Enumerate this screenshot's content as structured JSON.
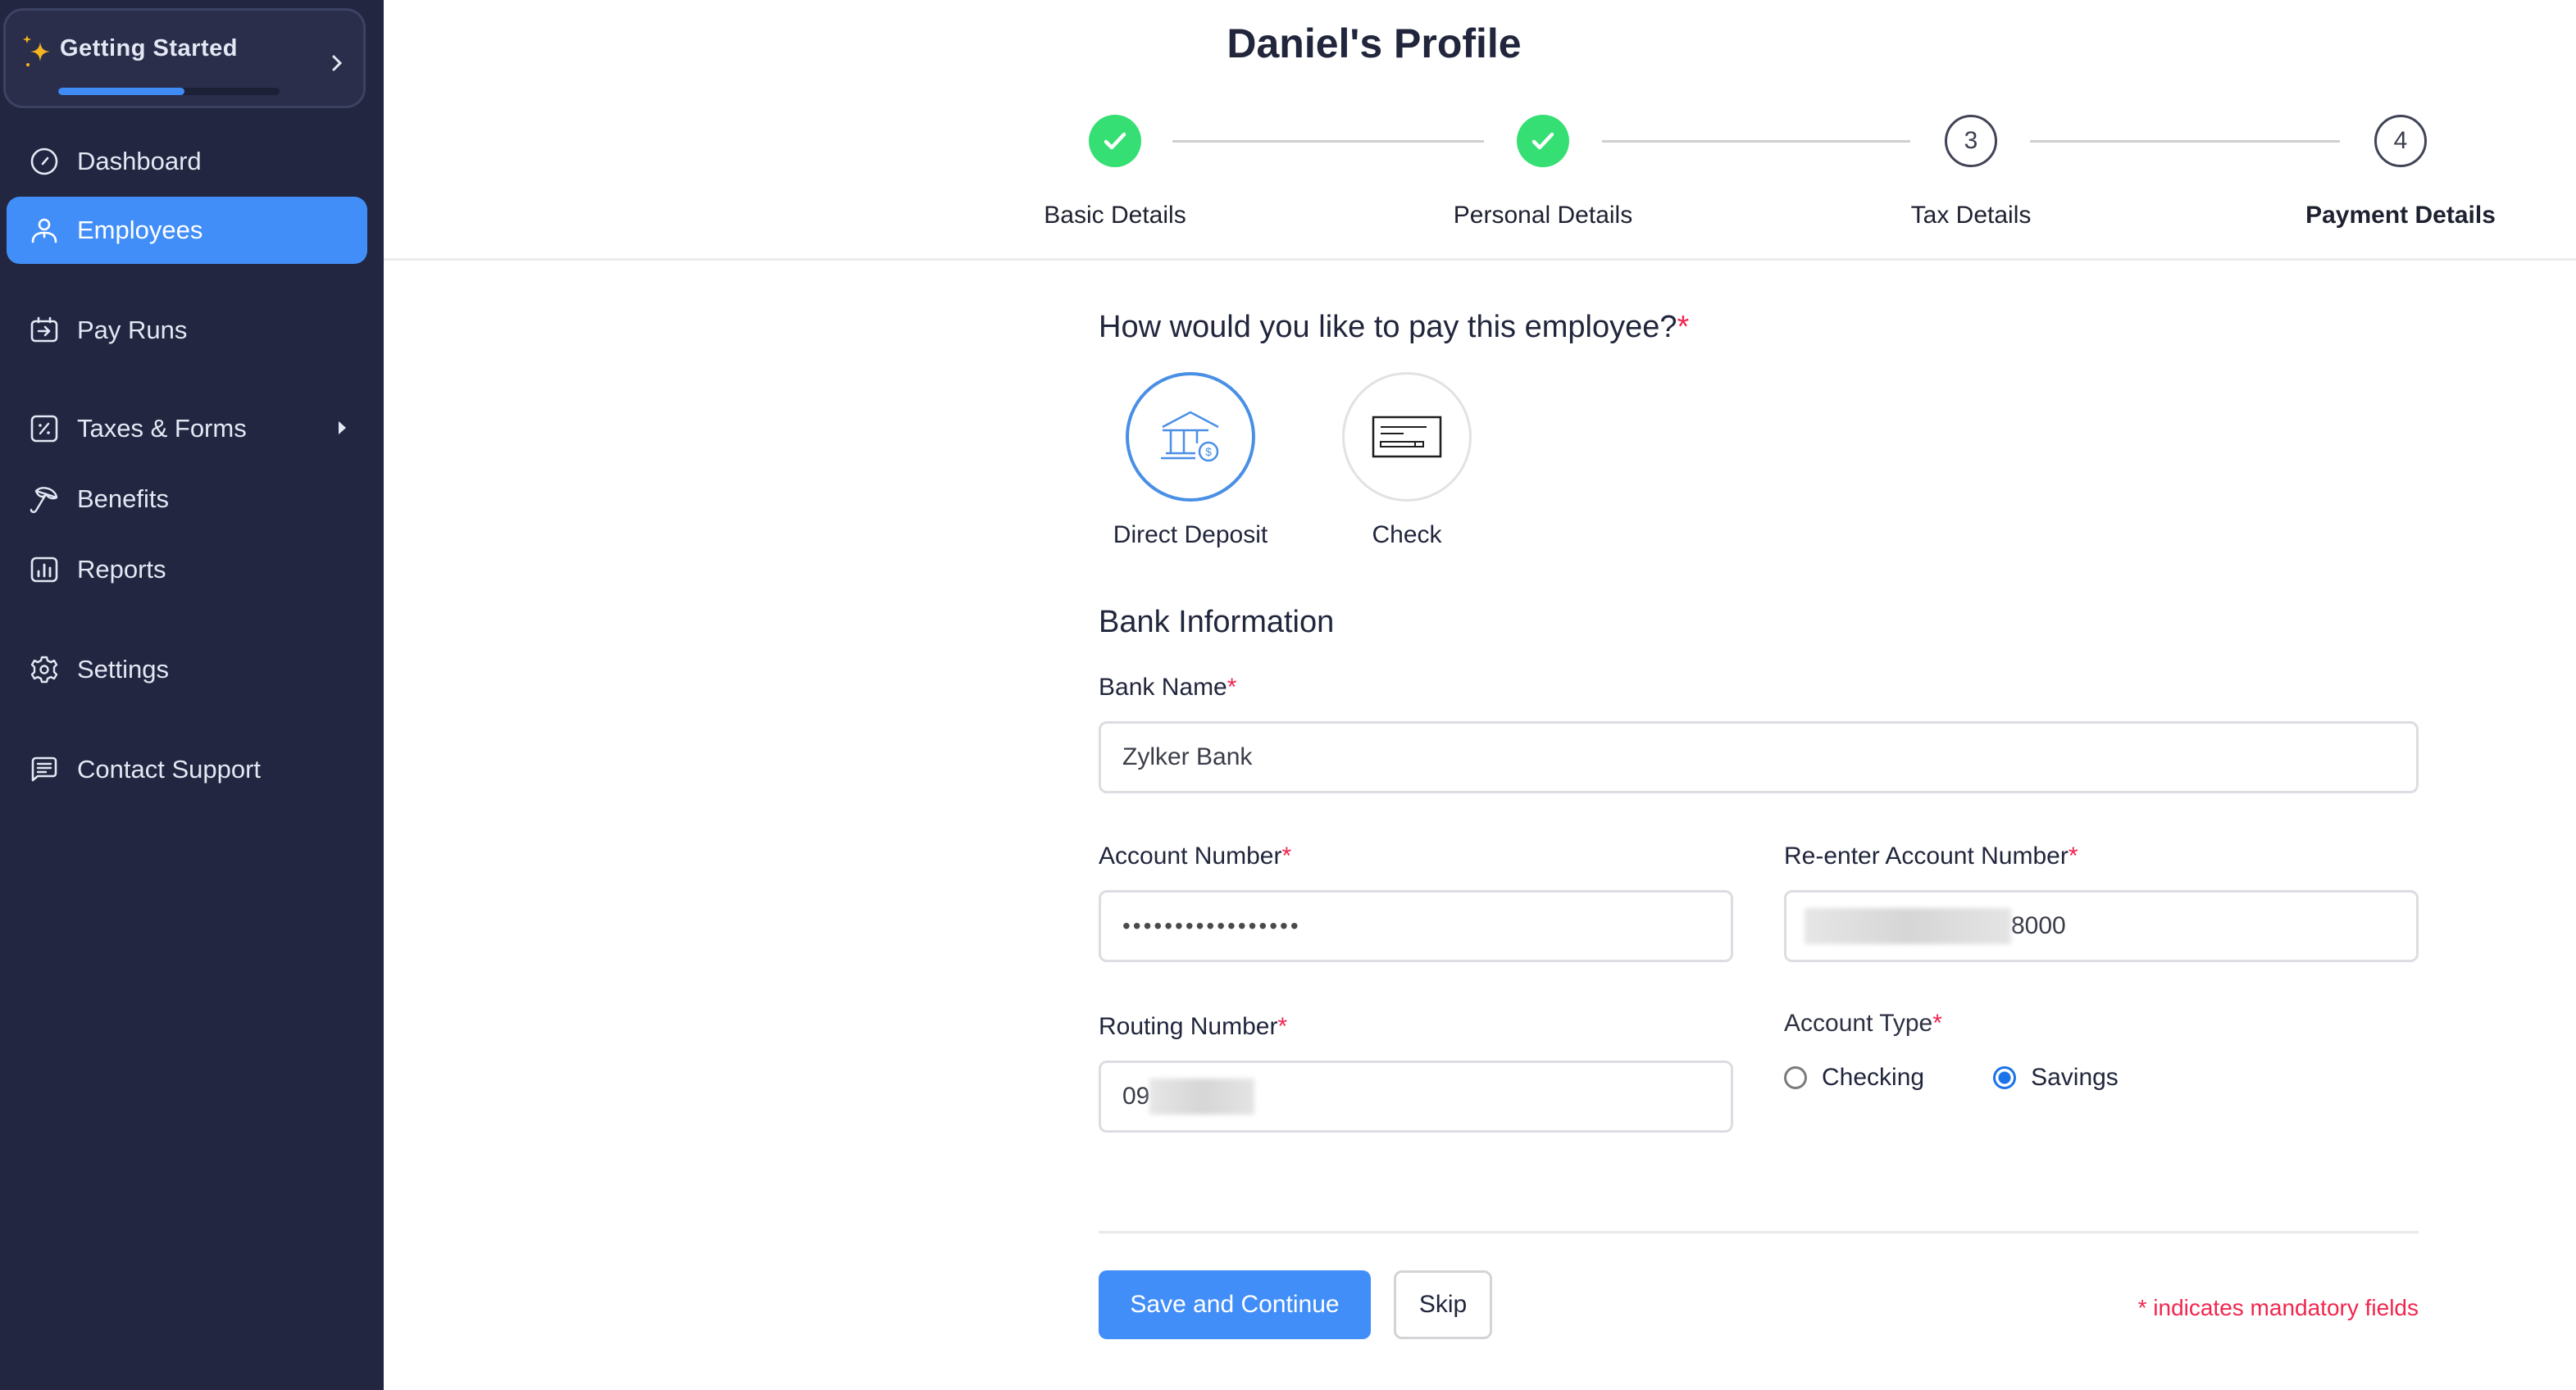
{
  "sidebar": {
    "getting_started": {
      "label": "Getting Started",
      "progress_percent": 57
    },
    "items": [
      {
        "label": "Dashboard",
        "icon": "dashboard-gauge-icon",
        "active": false
      },
      {
        "label": "Employees",
        "icon": "user-icon",
        "active": true
      },
      {
        "label": "Pay Runs",
        "icon": "pay-runs-icon",
        "active": false
      },
      {
        "label": "Taxes & Forms",
        "icon": "percent-tag-icon",
        "active": false,
        "has_submenu": true
      },
      {
        "label": "Benefits",
        "icon": "umbrella-icon",
        "active": false
      },
      {
        "label": "Reports",
        "icon": "bar-chart-icon",
        "active": false
      },
      {
        "label": "Settings",
        "icon": "gear-icon",
        "active": false
      },
      {
        "label": "Contact Support",
        "icon": "chat-icon",
        "active": false
      }
    ]
  },
  "header": {
    "title": "Daniel's Profile",
    "steps": [
      {
        "label": "Basic Details",
        "number": "1",
        "status": "completed"
      },
      {
        "label": "Personal Details",
        "number": "2",
        "status": "completed"
      },
      {
        "label": "Tax Details",
        "number": "3",
        "status": "pending"
      },
      {
        "label": "Payment Details",
        "number": "4",
        "status": "current"
      }
    ]
  },
  "form": {
    "question": "How would you like to pay this employee?",
    "required_mark": "*",
    "payment_methods": [
      {
        "label": "Direct Deposit",
        "icon": "bank-icon",
        "selected": true
      },
      {
        "label": "Check",
        "icon": "check-cheque-icon",
        "selected": false
      }
    ],
    "section_title": "Bank Information",
    "bank_name": {
      "label": "Bank Name",
      "value": "Zylker Bank"
    },
    "account_number": {
      "label": "Account Number",
      "value": "•••••••••••••••••"
    },
    "reenter_account_number": {
      "label": "Re-enter Account Number",
      "visible_suffix": "8000",
      "redacted": true
    },
    "routing_number": {
      "label": "Routing Number",
      "visible_prefix": "09",
      "redacted": true
    },
    "account_type": {
      "label": "Account Type",
      "options": [
        {
          "label": "Checking",
          "checked": false
        },
        {
          "label": "Savings",
          "checked": true
        }
      ]
    },
    "save_button": "Save and Continue",
    "skip_button": "Skip",
    "mandatory_note": "* indicates mandatory fields"
  },
  "colors": {
    "sidebar_bg": "#222640",
    "accent": "#428ef8",
    "success": "#36df74",
    "required": "#f0264f"
  }
}
